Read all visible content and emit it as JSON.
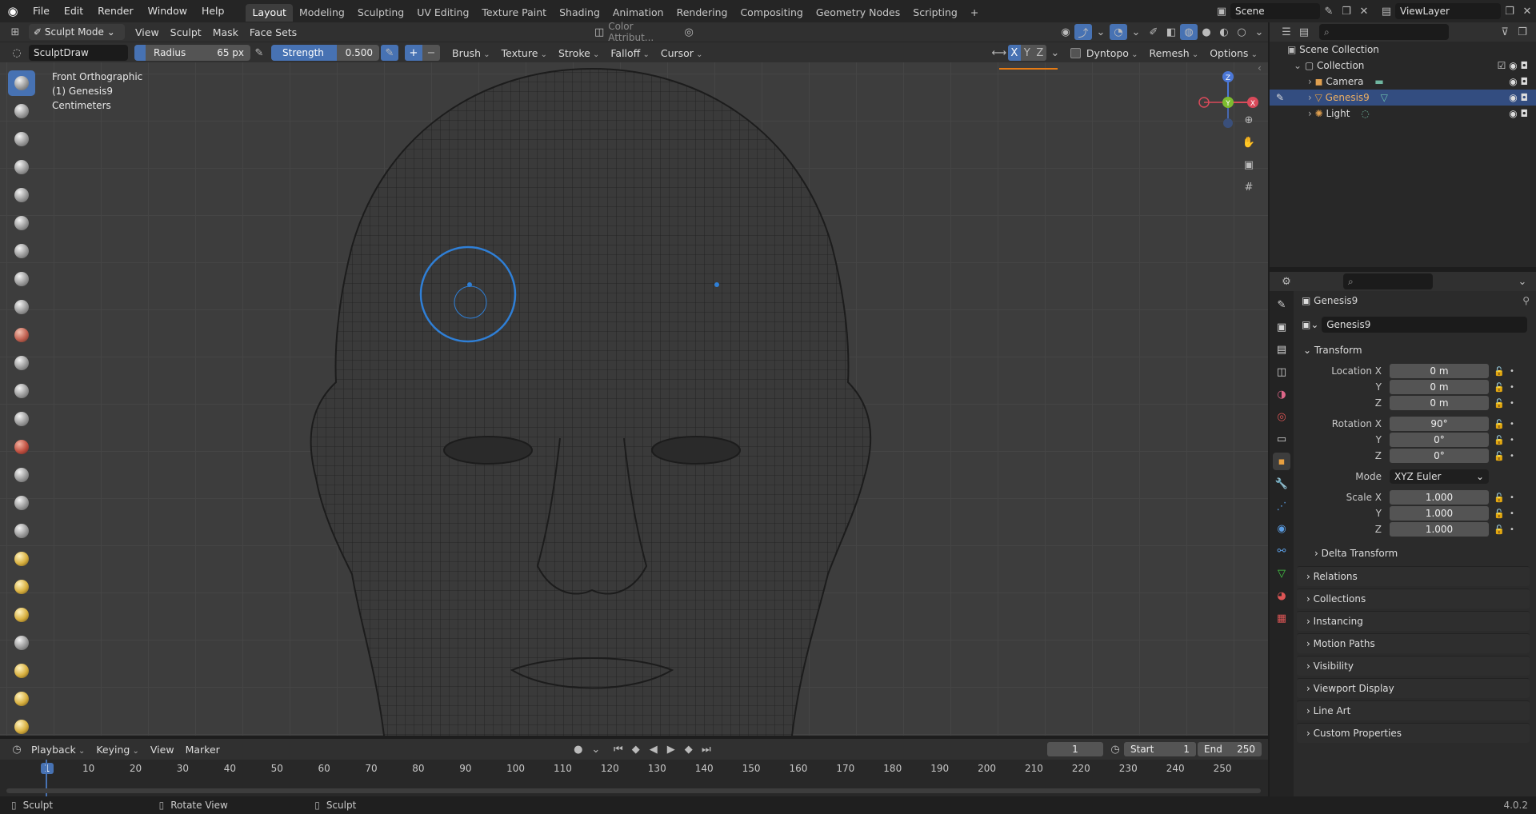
{
  "topbar": {
    "menus": [
      "File",
      "Edit",
      "Render",
      "Window",
      "Help"
    ],
    "workspaces": [
      "Layout",
      "Modeling",
      "Sculpting",
      "UV Editing",
      "Texture Paint",
      "Shading",
      "Animation",
      "Rendering",
      "Compositing",
      "Geometry Nodes",
      "Scripting"
    ],
    "active_workspace": "Layout",
    "add_tab": "+",
    "scene_name": "Scene",
    "view_layer": "ViewLayer"
  },
  "viewport_header": {
    "mode": "Sculpt Mode",
    "menus": [
      "View",
      "Sculpt",
      "Mask",
      "Face Sets"
    ],
    "color_attribute": "Color Attribut..."
  },
  "tool_header": {
    "brush_name": "SculptDraw",
    "radius_label": "Radius",
    "radius_value": "65 px",
    "strength_label": "Strength",
    "strength_value": "0.500",
    "plus": "+",
    "minus": "−",
    "dropdowns": [
      "Brush",
      "Texture",
      "Stroke",
      "Falloff",
      "Cursor"
    ],
    "axes": [
      "X",
      "Y",
      "Z"
    ],
    "dyntopo": "Dyntopo",
    "remesh": "Remesh",
    "options": "Options"
  },
  "viewport": {
    "overlay_lines": [
      "Front Orthographic",
      "(1) Genesis9",
      "Centimeters"
    ],
    "gizmo": {
      "z": "Z",
      "y": "Y",
      "x": "X"
    }
  },
  "outliner": {
    "root": "Scene Collection",
    "collection": "Collection",
    "items": [
      {
        "name": "Camera",
        "selected": false,
        "color": "#e0a050"
      },
      {
        "name": "Genesis9",
        "selected": true,
        "color": "#e8a040"
      },
      {
        "name": "Light",
        "selected": false,
        "color": "#e0a050"
      }
    ]
  },
  "properties": {
    "object_name": "Genesis9",
    "datablock": "Genesis9",
    "transform_title": "Transform",
    "location": {
      "label": "Location X",
      "x": "0 m",
      "y": "0 m",
      "z": "0 m"
    },
    "rotation": {
      "label": "Rotation X",
      "x": "90°",
      "y": "0°",
      "z": "0°"
    },
    "mode_label": "Mode",
    "mode_value": "XYZ Euler",
    "scale": {
      "label": "Scale X",
      "x": "1.000",
      "y": "1.000",
      "z": "1.000"
    },
    "axis_y": "Y",
    "axis_z": "Z",
    "delta": "Delta Transform",
    "panels": [
      "Relations",
      "Collections",
      "Instancing",
      "Motion Paths",
      "Visibility",
      "Viewport Display",
      "Line Art",
      "Custom Properties"
    ]
  },
  "timeline": {
    "menus": [
      "Playback",
      "Keying",
      "View",
      "Marker"
    ],
    "current_frame": "1",
    "start_label": "Start",
    "start": "1",
    "end_label": "End",
    "end": "250",
    "ruler": [
      "1",
      "10",
      "20",
      "30",
      "40",
      "50",
      "60",
      "70",
      "80",
      "90",
      "100",
      "110",
      "120",
      "130",
      "140",
      "150",
      "160",
      "170",
      "180",
      "190",
      "200",
      "210",
      "220",
      "230",
      "240",
      "250"
    ]
  },
  "statusbar": {
    "left": "Sculpt",
    "middle": "Rotate View",
    "right": "Sculpt",
    "version": "4.0.2"
  },
  "colors": {
    "accent": "#4772b3",
    "selection": "#334d80",
    "brush_circle": "#2f7fd6"
  }
}
